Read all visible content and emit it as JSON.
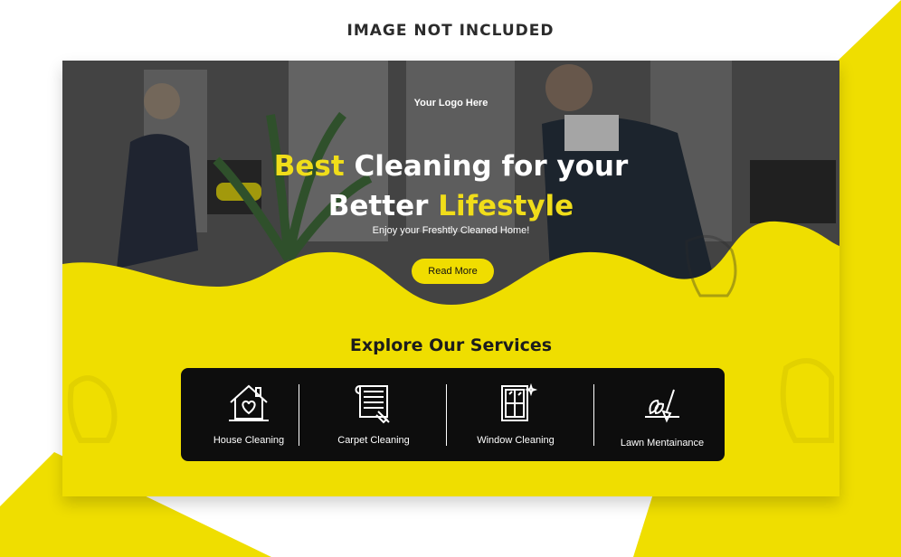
{
  "top_label": "IMAGE NOT INCLUDED",
  "hero": {
    "logo": "Your Logo Here",
    "headline": {
      "line1_highlight": "Best",
      "line1_rest": " Cleaning for your",
      "line2_start": "Better ",
      "line2_highlight": "Lifestyle"
    },
    "subtitle": "Enjoy your Freshtly Cleaned Home!",
    "cta_label": "Read More"
  },
  "services": {
    "title": "Explore Our Services",
    "items": [
      {
        "label": "House Cleaning",
        "icon": "house-heart-icon"
      },
      {
        "label": "Carpet Cleaning",
        "icon": "carpet-icon"
      },
      {
        "label": "Window Cleaning",
        "icon": "window-icon"
      },
      {
        "label": "Lawn Mentainance",
        "icon": "lawn-tools-icon"
      }
    ]
  },
  "colors": {
    "accent_yellow": "#efde00",
    "dark": "#0d0d0d",
    "hero_overlay": "#4a4a4a"
  }
}
